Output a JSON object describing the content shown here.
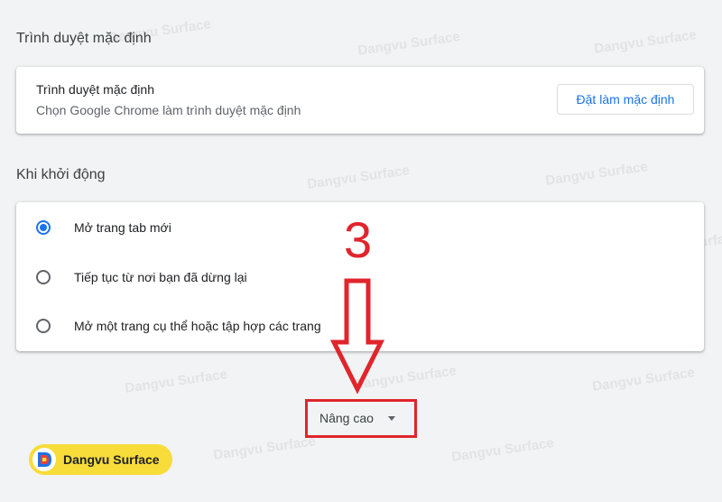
{
  "default_browser": {
    "section_title": "Trình duyệt mặc định",
    "row_title": "Trình duyệt mặc định",
    "row_subtitle": "Chọn Google Chrome làm trình duyệt mặc định",
    "button_label": "Đặt làm mặc định"
  },
  "on_startup": {
    "section_title": "Khi khởi động",
    "options": [
      {
        "label": "Mở trang tab mới",
        "selected": true
      },
      {
        "label": "Tiếp tục từ nơi bạn đã dừng lại",
        "selected": false
      },
      {
        "label": "Mở một trang cụ thể hoặc tập hợp các trang",
        "selected": false
      }
    ]
  },
  "advanced": {
    "label": "Nâng cao"
  },
  "annotation": {
    "step_number": "3",
    "highlight_color": "#e0252c"
  },
  "watermark": {
    "text": "Dangvu Surface",
    "logo_text": "Dangvu Surface"
  },
  "colors": {
    "accent": "#1a73e8",
    "background": "#f1f3f4",
    "logo_yellow": "#f7dc3a"
  }
}
